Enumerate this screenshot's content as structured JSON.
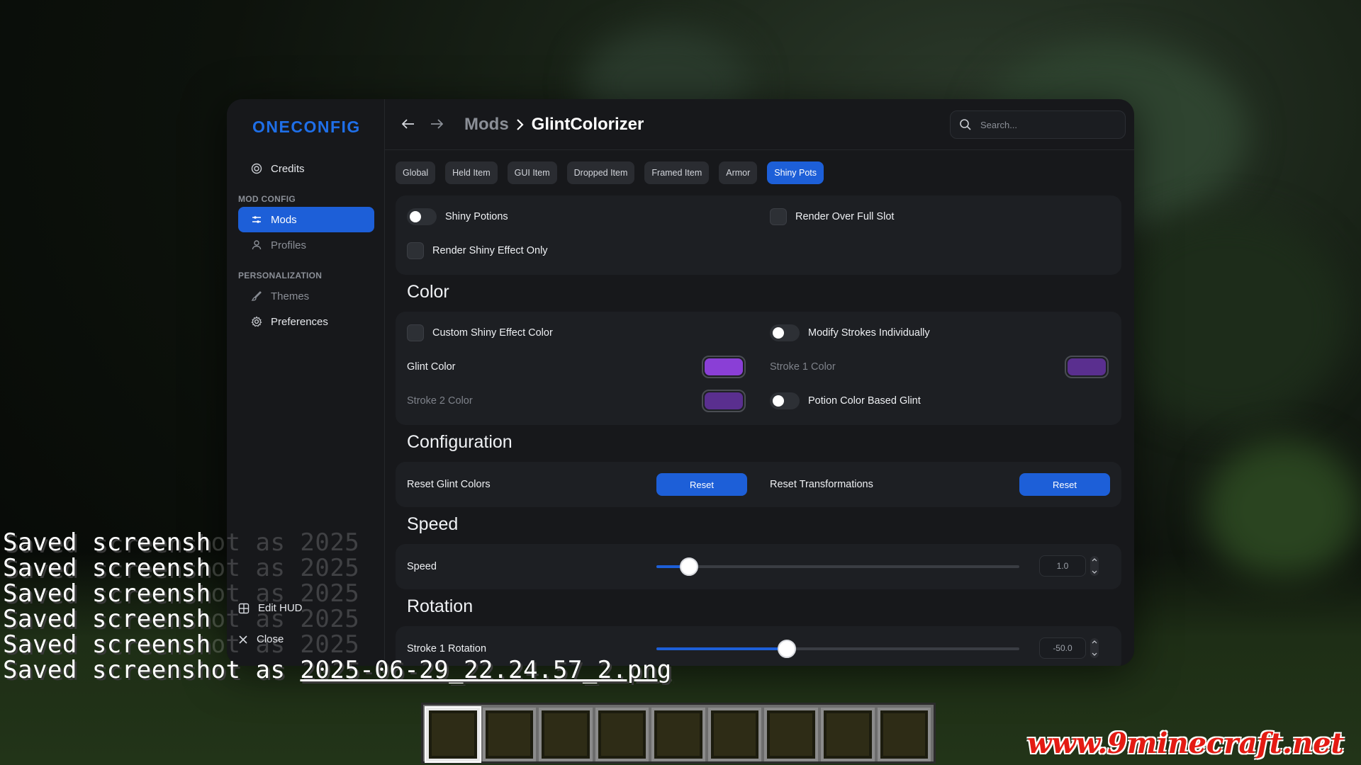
{
  "app": {
    "logo": "ONECONFIG",
    "accent": "#1d5fd8"
  },
  "sidebar": {
    "credits": "Credits",
    "section_mod_config": "MOD CONFIG",
    "mods": "Mods",
    "profiles": "Profiles",
    "section_personalization": "PERSONALIZATION",
    "themes": "Themes",
    "preferences": "Preferences",
    "edit_hud": "Edit HUD",
    "close": "Close"
  },
  "header": {
    "breadcrumb_parent": "Mods",
    "breadcrumb_separator": ">",
    "breadcrumb_current": "GlintColorizer",
    "search_placeholder": "Search..."
  },
  "tabs": [
    {
      "label": "Global"
    },
    {
      "label": "Held Item"
    },
    {
      "label": "GUI Item"
    },
    {
      "label": "Dropped Item"
    },
    {
      "label": "Framed Item"
    },
    {
      "label": "Armor"
    },
    {
      "label": "Shiny Pots",
      "active": true
    }
  ],
  "general": {
    "shiny_potions": "Shiny Potions",
    "render_over_full_slot": "Render Over Full Slot",
    "render_shiny_effect_only": "Render Shiny Effect Only"
  },
  "color": {
    "title": "Color",
    "custom_shiny_effect_color": "Custom Shiny Effect Color",
    "modify_strokes_individually": "Modify Strokes Individually",
    "glint_color": "Glint Color",
    "glint_color_value": "#8a3fd6",
    "stroke1_color": "Stroke 1 Color",
    "stroke1_color_value": "#5a2f8f",
    "stroke2_color": "Stroke 2 Color",
    "stroke2_color_value": "#5a2f8f",
    "potion_color_based_glint": "Potion Color Based Glint"
  },
  "configuration": {
    "title": "Configuration",
    "reset_glint_colors": "Reset Glint Colors",
    "reset_transformations": "Reset Transformations",
    "reset_label": "Reset"
  },
  "speed": {
    "title": "Speed",
    "label": "Speed",
    "value": "1.0",
    "fraction": 0.09
  },
  "rotation": {
    "title": "Rotation",
    "label": "Stroke 1 Rotation",
    "value": "-50.0",
    "fraction": 0.36
  },
  "chat": {
    "prefix": "Saved screenshot as ",
    "lines": [
      {
        "visible": "Saved screensh",
        "faded": "ot as 2025"
      },
      {
        "visible": "Saved screensh",
        "faded": "ot as 2025"
      },
      {
        "visible": "Saved screensh",
        "faded": "ot as 2025"
      },
      {
        "visible": "Saved screensh",
        "faded": "ot as 2025"
      },
      {
        "visible": "Saved screensh",
        "faded": "ot as 2025"
      }
    ],
    "last_line_text": "Saved screenshot as ",
    "last_line_file": "2025-06-29_22.24.57_2.png"
  },
  "watermark": "www.9minecraft.net"
}
